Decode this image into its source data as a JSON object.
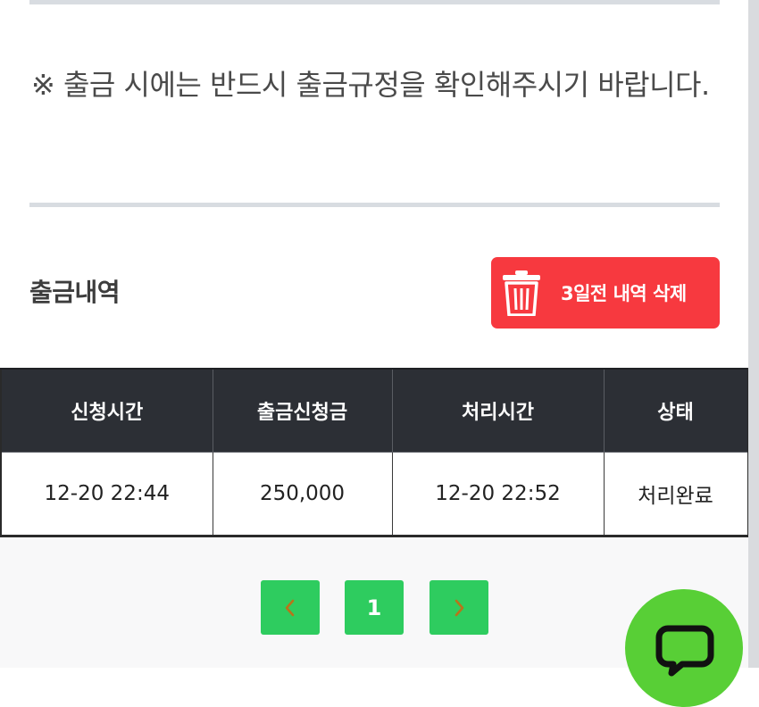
{
  "notice": {
    "text": "※ 출금 시에는 반드시 출금규정을 확인해주시기 바랍니다."
  },
  "history": {
    "title": "출금내역",
    "delete_button_label": "3일전 내역 삭제",
    "columns": [
      "신청시간",
      "출금신청금",
      "처리시간",
      "상태"
    ],
    "rows": [
      {
        "request_time": "12-20 22:44",
        "amount": "250,000",
        "processed_time": "12-20 22:52",
        "status": "처리완료"
      }
    ]
  },
  "pagination": {
    "current_page": "1",
    "prev_icon": "chevron-left-icon",
    "next_icon": "chevron-right-icon"
  },
  "colors": {
    "delete_button": "#f7393f",
    "table_header": "#2c2f35",
    "pager_button": "#2ecc5f",
    "chevron": "#b8741a",
    "chat_button": "#58cf36"
  },
  "icons": {
    "delete": "trash-icon",
    "chat": "chat-bubble-icon"
  }
}
